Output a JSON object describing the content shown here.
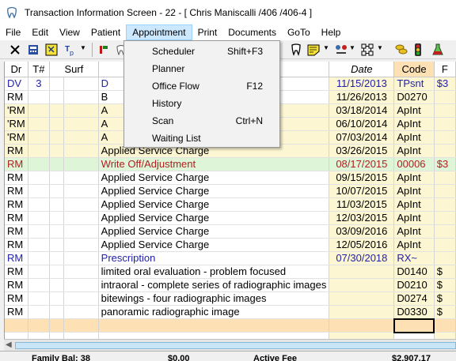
{
  "window": {
    "title": "Transaction Information Screen - 22 - [ Chris Maniscalli /406 /406-4 ]"
  },
  "menu": [
    "File",
    "Edit",
    "View",
    "Patient",
    "Appointment",
    "Print",
    "Documents",
    "GoTo",
    "Help"
  ],
  "appointment_menu": [
    {
      "label": "Scheduler",
      "shortcut": "Shift+F3"
    },
    {
      "label": "Planner",
      "shortcut": ""
    },
    {
      "label": "Office Flow",
      "shortcut": "F12"
    },
    {
      "label": "History",
      "shortcut": ""
    },
    {
      "label": "Scan",
      "shortcut": "Ctrl+N"
    },
    {
      "label": "Waiting List",
      "shortcut": ""
    }
  ],
  "toolbar_icons": [
    "close-x-icon",
    "calculator-icon",
    "note-icon",
    "tag-icon",
    "flag-icon",
    "tooth-icon",
    "teeth-icon",
    "note-pad-icon",
    "cycle-icon",
    "network-icon",
    "coins-icon",
    "traffic-light-icon",
    "flask-icon"
  ],
  "grid": {
    "columns": [
      "Dr",
      "T#",
      "Surf",
      "",
      "Date",
      "Code",
      "F"
    ],
    "rows": [
      {
        "style": "blue",
        "dr": "DV",
        "t": "3",
        "surf": "",
        "desc": "D",
        "date": "11/15/2013",
        "code": "TPsnt",
        "fee": "$3"
      },
      {
        "style": "",
        "dr": "RM",
        "t": "",
        "surf": "",
        "desc": "B",
        "date": "11/26/2013",
        "code": "D0270",
        "fee": ""
      },
      {
        "style": "yellow",
        "dr": "'RM",
        "t": "",
        "surf": "",
        "desc": "A",
        "date": "03/18/2014",
        "code": "ApInt",
        "fee": ""
      },
      {
        "style": "yellow",
        "dr": "'RM",
        "t": "",
        "surf": "",
        "desc": "A",
        "date": "06/10/2014",
        "code": "ApInt",
        "fee": ""
      },
      {
        "style": "yellow",
        "dr": "'RM",
        "t": "",
        "surf": "",
        "desc": "A",
        "date": "07/03/2014",
        "code": "ApInt",
        "fee": ""
      },
      {
        "style": "yellow",
        "dr": "RM",
        "t": "",
        "surf": "",
        "desc": "Applied Service Charge",
        "date": "03/26/2015",
        "code": "ApInt",
        "fee": ""
      },
      {
        "style": "green red",
        "dr": "RM",
        "t": "",
        "surf": "",
        "desc": "Write Off/Adjustment",
        "date": "08/17/2015",
        "code": "00006",
        "fee": "$3"
      },
      {
        "style": "",
        "dr": "RM",
        "t": "",
        "surf": "",
        "desc": "Applied Service Charge",
        "date": "09/15/2015",
        "code": "ApInt",
        "fee": ""
      },
      {
        "style": "",
        "dr": "RM",
        "t": "",
        "surf": "",
        "desc": "Applied Service Charge",
        "date": "10/07/2015",
        "code": "ApInt",
        "fee": ""
      },
      {
        "style": "",
        "dr": "RM",
        "t": "",
        "surf": "",
        "desc": "Applied Service Charge",
        "date": "11/03/2015",
        "code": "ApInt",
        "fee": ""
      },
      {
        "style": "",
        "dr": "RM",
        "t": "",
        "surf": "",
        "desc": "Applied Service Charge",
        "date": "12/03/2015",
        "code": "ApInt",
        "fee": ""
      },
      {
        "style": "",
        "dr": "RM",
        "t": "",
        "surf": "",
        "desc": "Applied Service Charge",
        "date": "03/09/2016",
        "code": "ApInt",
        "fee": ""
      },
      {
        "style": "",
        "dr": "RM",
        "t": "",
        "surf": "",
        "desc": "Applied Service Charge",
        "date": "12/05/2016",
        "code": "ApInt",
        "fee": ""
      },
      {
        "style": "blue",
        "dr": "RM",
        "t": "",
        "surf": "",
        "desc": "Prescription",
        "date": "07/30/2018",
        "code": "RX~",
        "fee": ""
      },
      {
        "style": "",
        "dr": "RM",
        "t": "",
        "surf": "",
        "desc": "limited oral evaluation - problem focused",
        "date": "",
        "code": "D0140",
        "fee": "$"
      },
      {
        "style": "",
        "dr": "RM",
        "t": "",
        "surf": "",
        "desc": "intraoral - complete series of radiographic images",
        "date": "",
        "code": "D0210",
        "fee": "$"
      },
      {
        "style": "",
        "dr": "RM",
        "t": "",
        "surf": "",
        "desc": "bitewings - four radiographic images",
        "date": "",
        "code": "D0274",
        "fee": "$"
      },
      {
        "style": "",
        "dr": "RM",
        "t": "",
        "surf": "",
        "desc": "panoramic radiographic image",
        "date": "",
        "code": "D0330",
        "fee": "$"
      }
    ]
  },
  "colors": {
    "accent": "#cce8ff",
    "code_header": "#fde1b5",
    "cell_yellow": "#fdf6d3",
    "row_green": "#dff5d8",
    "text_blue": "#1f1fa8",
    "text_red": "#b02020"
  },
  "status": {
    "left": "Family Bal: 38",
    "mid": "$0.00",
    "right1": "Active Fee",
    "right2": "$2,907.17"
  }
}
